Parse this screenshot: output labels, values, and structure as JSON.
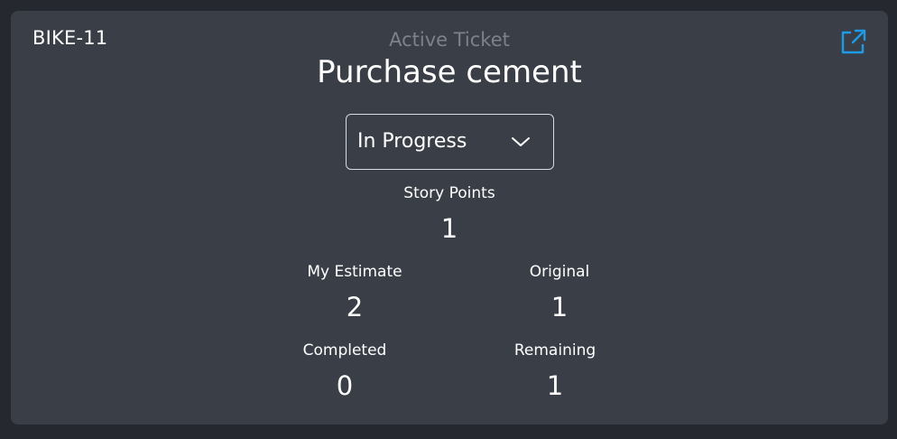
{
  "ticket": {
    "key": "BIKE-11",
    "subtitle": "Active Ticket",
    "title": "Purchase cement",
    "open_link_icon": "external-link-icon",
    "accent_color": "#1e9be8"
  },
  "status": {
    "value": "In Progress",
    "icon": "chevron-down-icon"
  },
  "stats": {
    "story_points": {
      "label": "Story Points",
      "value": "1"
    },
    "my_estimate": {
      "label": "My Estimate",
      "value": "2"
    },
    "original": {
      "label": "Original",
      "value": "1"
    },
    "completed": {
      "label": "Completed",
      "value": "0"
    },
    "remaining": {
      "label": "Remaining",
      "value": "1"
    }
  }
}
